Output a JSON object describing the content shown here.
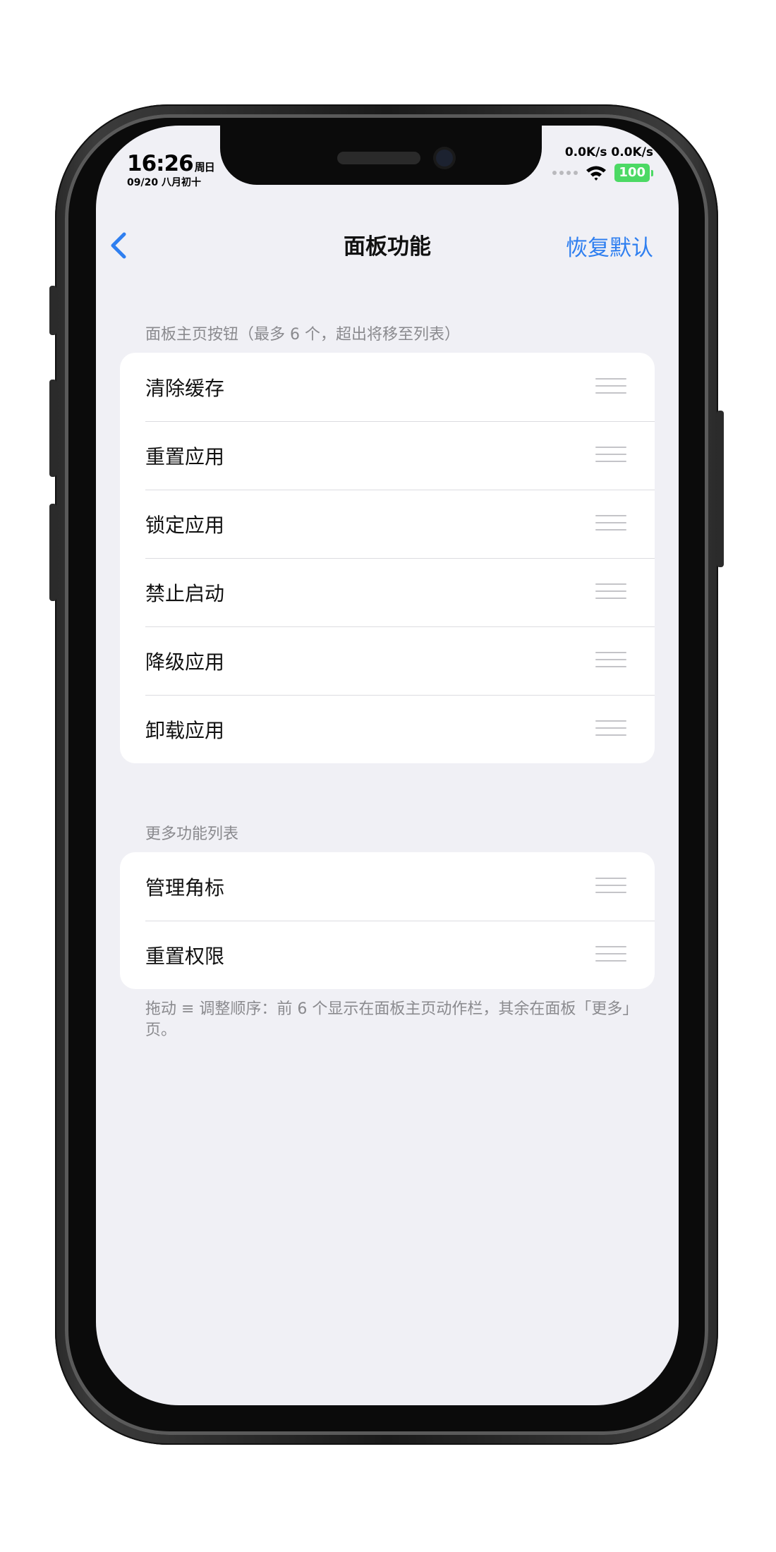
{
  "status_bar": {
    "time": "16:26",
    "weekday": "周日",
    "date": "09/20 八月初十",
    "net_speed": "0.0K/s 0.0K/s",
    "battery": "100",
    "icons": [
      "signal-dots-icon",
      "wifi-icon",
      "battery-icon"
    ]
  },
  "nav": {
    "title": "面板功能",
    "back_icon": "chevron-left-icon",
    "restore_label": "恢复默认"
  },
  "main_section": {
    "header": "面板主页按钮（最多 6 个，超出将移至列表）",
    "items": [
      {
        "label": "清除缓存"
      },
      {
        "label": "重置应用"
      },
      {
        "label": "锁定应用"
      },
      {
        "label": "禁止启动"
      },
      {
        "label": "降级应用"
      },
      {
        "label": "卸载应用"
      }
    ]
  },
  "more_section": {
    "header": "更多功能列表",
    "items": [
      {
        "label": "管理角标"
      },
      {
        "label": "重置权限"
      }
    ],
    "footer": "拖动 ≡ 调整顺序：前 6 个显示在面板主页动作栏，其余在面板「更多」页。"
  },
  "colors": {
    "accent": "#2f7ff0",
    "background": "#f0f0f5",
    "battery": "#4cd964",
    "secondary_text": "#8a8a8e"
  }
}
